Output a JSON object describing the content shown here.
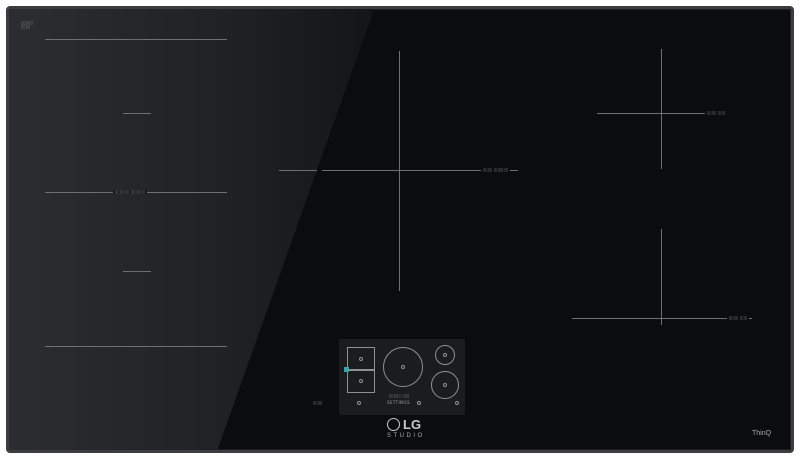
{
  "brand": {
    "logo_text": "LG",
    "sub_brand": "STUDIO",
    "smart_badge": "ThinQ"
  },
  "controls": {
    "center_button_label": "SETTINGS"
  },
  "colors": {
    "glass": "#0b0c0d",
    "frame": "#3b3d40",
    "graphics": "#8e9093"
  }
}
